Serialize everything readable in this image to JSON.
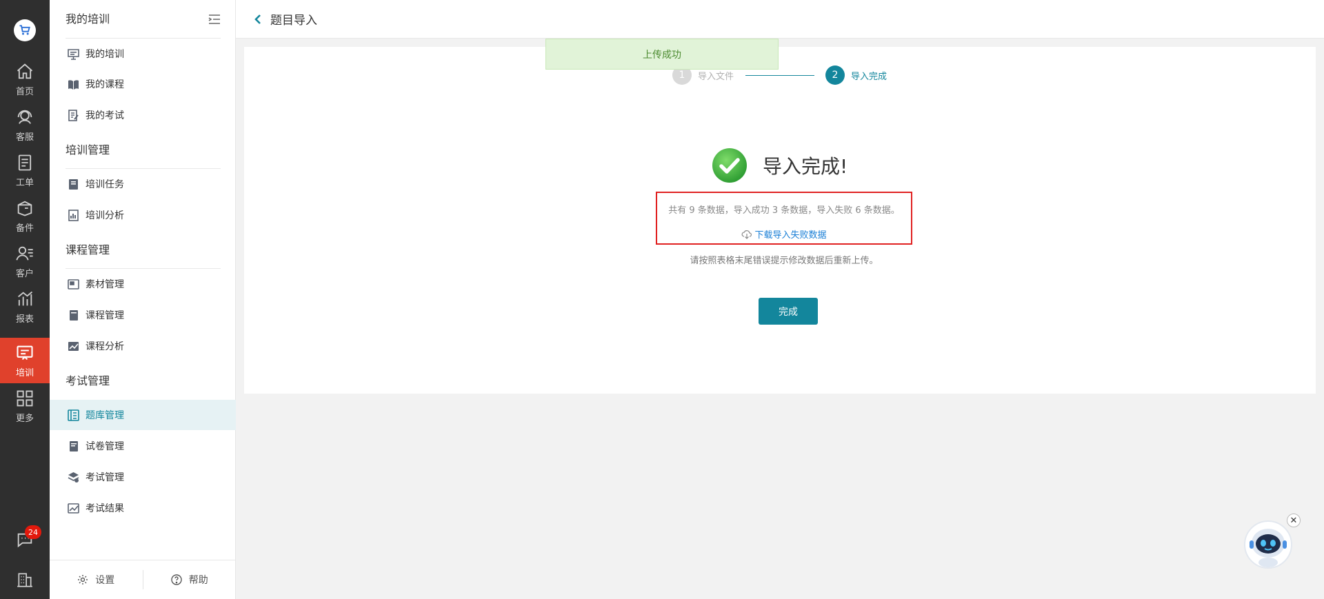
{
  "rail": {
    "items": [
      {
        "label": "首页",
        "icon": "home-icon"
      },
      {
        "label": "客服",
        "icon": "headset-icon"
      },
      {
        "label": "工单",
        "icon": "clipboard-icon"
      },
      {
        "label": "备件",
        "icon": "box-icon"
      },
      {
        "label": "客户",
        "icon": "user-icon"
      },
      {
        "label": "报表",
        "icon": "chart-icon"
      },
      {
        "label": "培训",
        "icon": "training-icon",
        "active": true
      },
      {
        "label": "更多",
        "icon": "grid-icon"
      }
    ],
    "message_badge": "24"
  },
  "sidebar": {
    "group_my": "我的培训",
    "my_items": [
      "我的培训",
      "我的课程",
      "我的考试"
    ],
    "group_train": "培训管理",
    "train_items": [
      "培训任务",
      "培训分析"
    ],
    "group_course": "课程管理",
    "course_items": [
      "素材管理",
      "课程管理",
      "课程分析"
    ],
    "group_exam": "考试管理",
    "exam_items": [
      "题库管理",
      "试卷管理",
      "考试管理",
      "考试结果"
    ],
    "active_item": "题库管理",
    "settings_label": "设置",
    "help_label": "帮助"
  },
  "header": {
    "title": "题目导入"
  },
  "toast": {
    "message": "上传成功"
  },
  "steps": {
    "step1": {
      "number": "1",
      "label": "导入文件"
    },
    "step2": {
      "number": "2",
      "label": "导入完成"
    }
  },
  "result": {
    "title": "导入完成!",
    "summary": "共有 9 条数据，导入成功 3 条数据，导入失败 6 条数据。",
    "download_label": "下载导入失败数据",
    "hint": "请按照表格末尾错误提示修改数据后重新上传。",
    "finish_label": "完成"
  },
  "colors": {
    "accent": "#13869c",
    "rail_active": "#e0412c",
    "error_border": "#e02020",
    "link": "#1a7fd6",
    "success": "#4caf50"
  }
}
